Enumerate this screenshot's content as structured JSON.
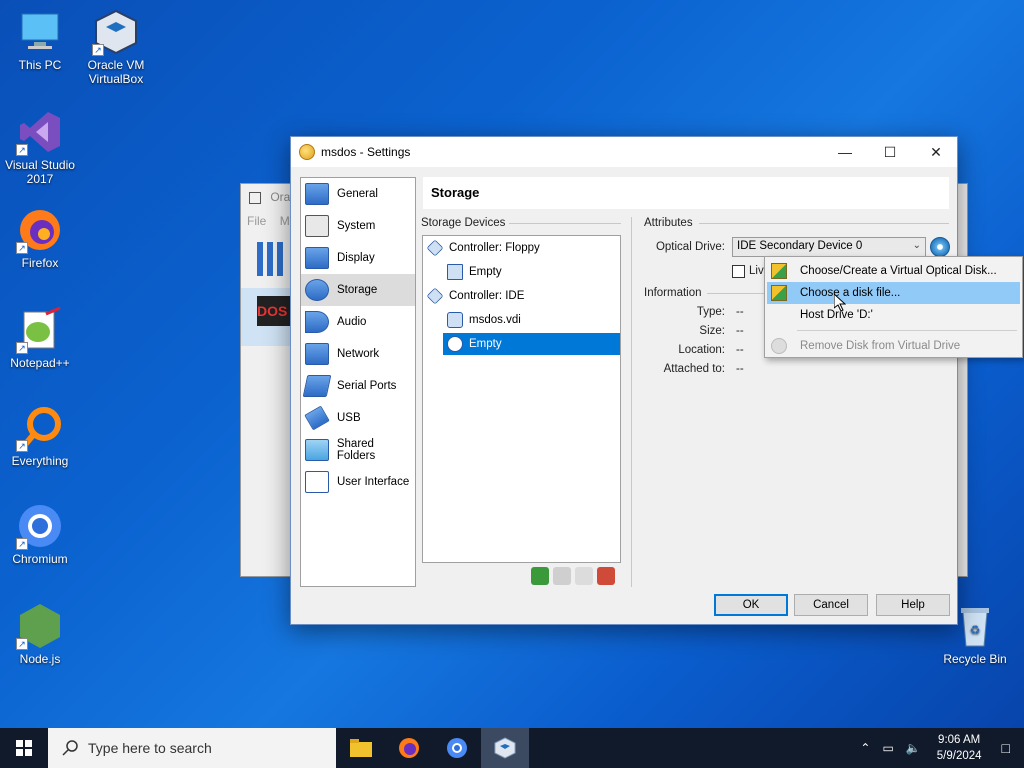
{
  "desktop": {
    "icons": [
      {
        "label": "This PC",
        "icon": "computer-icon"
      },
      {
        "label": "Oracle VM VirtualBox",
        "icon": "virtualbox-icon"
      },
      {
        "label": "Visual Studio 2017",
        "icon": "visual-studio-icon"
      },
      {
        "label": "Firefox",
        "icon": "firefox-icon"
      },
      {
        "label": "Notepad++",
        "icon": "notepadpp-icon"
      },
      {
        "label": "Everything",
        "icon": "everything-icon"
      },
      {
        "label": "Chromium",
        "icon": "chromium-icon"
      },
      {
        "label": "Node.js",
        "icon": "nodejs-icon"
      },
      {
        "label": "Recycle Bin",
        "icon": "recycle-bin-icon"
      }
    ]
  },
  "background_window": {
    "title": "Ora",
    "menu_file": "File",
    "menu_m": "M"
  },
  "dialog": {
    "title": "msdos - Settings",
    "nav": [
      {
        "label": "General"
      },
      {
        "label": "System"
      },
      {
        "label": "Display"
      },
      {
        "label": "Storage"
      },
      {
        "label": "Audio"
      },
      {
        "label": "Network"
      },
      {
        "label": "Serial Ports"
      },
      {
        "label": "USB"
      },
      {
        "label": "Shared Folders"
      },
      {
        "label": "User Interface"
      }
    ],
    "active_nav": "Storage",
    "page_title": "Storage",
    "storage_devices_label": "Storage Devices",
    "tree": {
      "floppy_controller": "Controller: Floppy",
      "floppy_empty": "Empty",
      "ide_controller": "Controller: IDE",
      "vdi": "msdos.vdi",
      "ide_empty": "Empty"
    },
    "attributes": {
      "heading": "Attributes",
      "optical_drive_label": "Optical Drive:",
      "optical_drive_value": "IDE Secondary Device 0",
      "live_cd_label": "Live"
    },
    "information": {
      "heading": "Information",
      "type_label": "Type:",
      "type_value": "--",
      "size_label": "Size:",
      "size_value": "--",
      "location_label": "Location:",
      "location_value": "--",
      "attached_label": "Attached to:",
      "attached_value": "--"
    },
    "buttons": {
      "ok": "OK",
      "cancel": "Cancel",
      "help": "Help"
    }
  },
  "context_menu": {
    "items": [
      {
        "label": "Choose/Create a Virtual Optical Disk..."
      },
      {
        "label": "Choose a disk file..."
      },
      {
        "label": "Host Drive 'D:'"
      },
      {
        "label": "Remove Disk from Virtual Drive"
      }
    ],
    "highlighted": "Choose a disk file..."
  },
  "taskbar": {
    "search_placeholder": "Type here to search",
    "time": "9:06 AM",
    "date": "5/9/2024"
  },
  "colors": {
    "selection": "#0078d7",
    "menu_highlight": "#91c9f7",
    "taskbar": "#101a2a"
  }
}
